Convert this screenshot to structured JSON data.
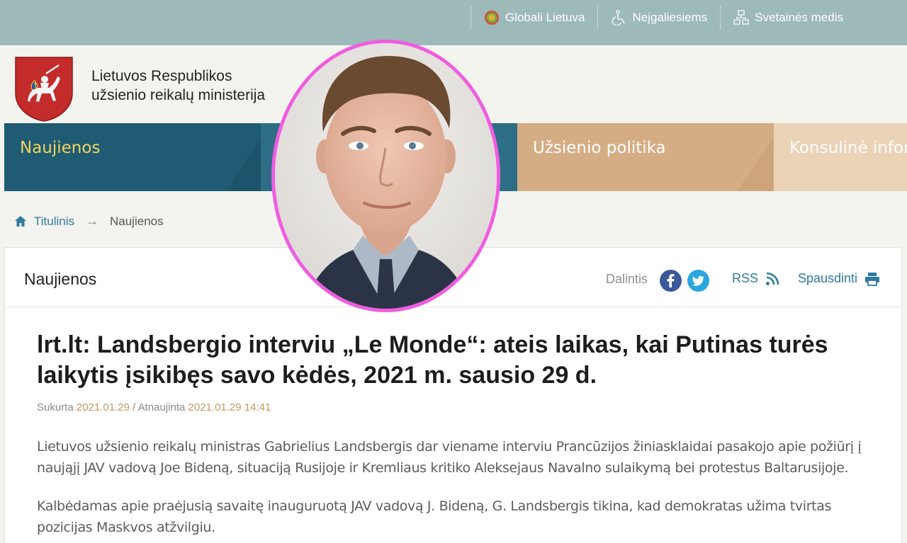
{
  "topbar": {
    "links": [
      {
        "label": "Globali Lietuva",
        "icon": "globe-icon"
      },
      {
        "label": "Neįgaliesiems",
        "icon": "wheelchair-icon"
      },
      {
        "label": "Svetainės medis",
        "icon": "sitemap-icon"
      }
    ]
  },
  "header": {
    "org_line1": "Lietuvos Respublikos",
    "org_line2": "užsienio reikalų ministerija",
    "logo": "coat-of-arms-vytis"
  },
  "nav": {
    "items": [
      {
        "label": "Naujienos"
      },
      {
        "label": ""
      },
      {
        "label": "Užsienio politika"
      },
      {
        "label": "Konsulinė infor"
      }
    ]
  },
  "breadcrumb": {
    "home": "Titulinis",
    "current": "Naujienos"
  },
  "panel": {
    "title": "Naujienos",
    "share_label": "Dalintis",
    "rss_label": "RSS",
    "print_label": "Spausdinti"
  },
  "article": {
    "title": "lrt.lt: Landsbergio interviu „Le Monde“: ateis laikas, kai Putinas turės laikytis įsikibęs savo kėdės, 2021 m. sausio 29 d.",
    "created_label": "Sukurta",
    "created": "2021.01.29",
    "updated_label": "/ Atnaujinta",
    "updated": "2021.01.29 14:41",
    "p1": "Lietuvos užsienio reikalų ministras Gabrielius Landsbergis dar viename interviu Prancūzijos žiniasklaidai pasakojo apie požiūrį į naująjį JAV vadovą Joe Bideną, situaciją Rusijoje ir Kremliaus kritiko Aleksejaus Navalno sulaikymą bei protestus Baltarusijoje.",
    "p2": "Kalbėdamas apie praėjusią savaitę inauguruotą JAV vadovą J. Bideną, G. Landsbergis tikina, kad demokratas užima tvirtas pozicijas Maskvos atžvilgiu."
  },
  "colors": {
    "topbar": "#9eb9ba",
    "nav_active": "#1f5b73",
    "nav_active_text": "#f2d45c",
    "nav_politika": "#d5ad84",
    "link": "#2f7aa1",
    "portrait_ring": "#f05ce0"
  }
}
